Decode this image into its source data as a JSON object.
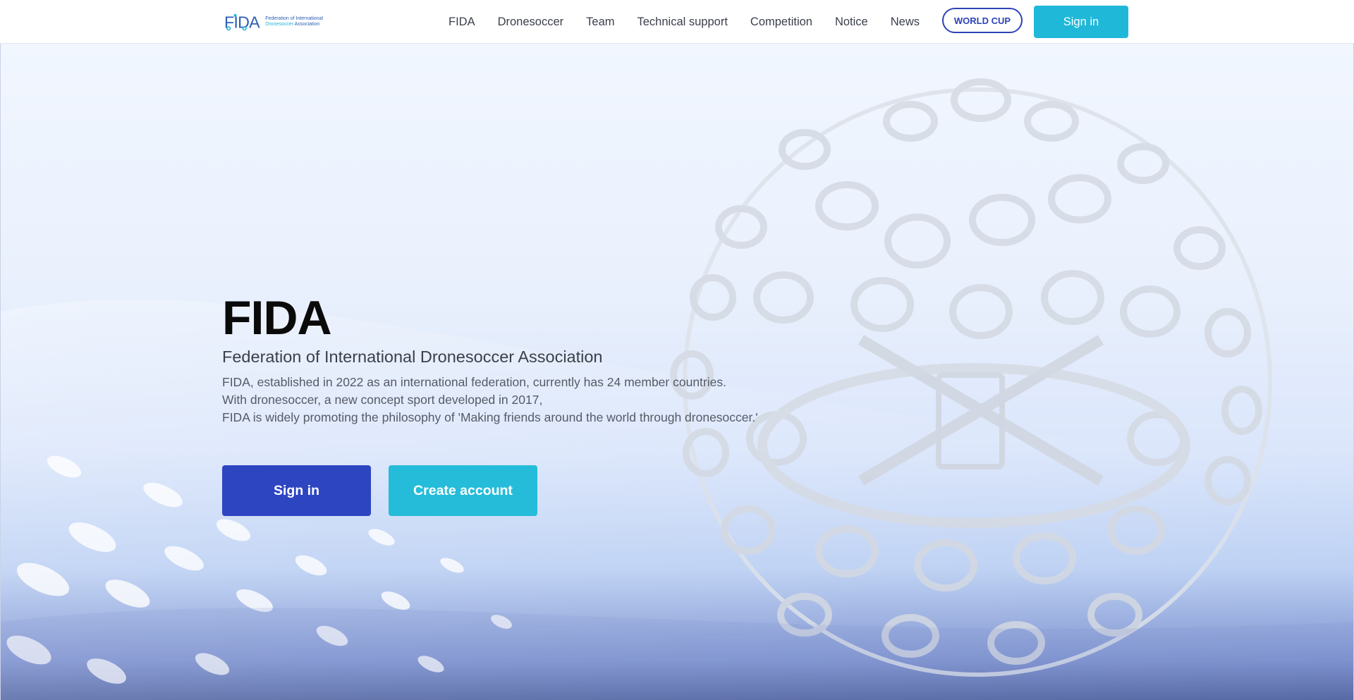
{
  "header": {
    "logo": {
      "mark": "FIDA",
      "line1": "Federation of International",
      "line2_part1": "Dronesoccer",
      "line2_part2": " Association"
    },
    "nav": [
      {
        "label": "FIDA"
      },
      {
        "label": "Dronesoccer"
      },
      {
        "label": "Team"
      },
      {
        "label": "Technical support"
      },
      {
        "label": "Competition"
      },
      {
        "label": "Notice"
      },
      {
        "label": "News"
      }
    ],
    "world_cup_label": "WORLD CUP",
    "sign_in_label": "Sign in"
  },
  "hero": {
    "title": "FIDA",
    "subtitle": "Federation of International Dronesoccer Association",
    "description": [
      "FIDA, established in 2022 as an international federation, currently has 24 member countries.",
      "With dronesoccer, a new concept sport developed in 2017,",
      "FIDA is widely promoting the philosophy of 'Making friends around the world through dronesoccer.'"
    ],
    "sign_in_label": "Sign in",
    "create_account_label": "Create account"
  },
  "colors": {
    "brand_blue": "#2e45c2",
    "brand_cyan": "#1fb8d8",
    "nav_text": "#3a3f4b"
  },
  "icons": {
    "logo": "fida-logo-icon",
    "background": "drone-ball-illustration"
  }
}
